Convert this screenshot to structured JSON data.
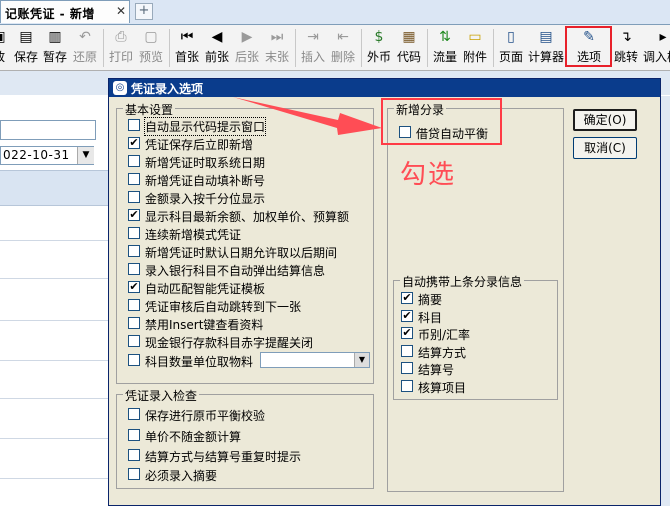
{
  "tab": {
    "title": "记账凭证 - 新增",
    "close": "✕",
    "new": "+"
  },
  "toolbar": {
    "items": [
      {
        "label": "放",
        "icon": "▣"
      },
      {
        "label": "保存",
        "icon": "▤"
      },
      {
        "label": "暂存",
        "icon": "▥"
      },
      {
        "label": "还原",
        "icon": "↶"
      },
      {
        "label": "打印",
        "icon": "⎙"
      },
      {
        "label": "预览",
        "icon": "▢"
      },
      {
        "label": "首张",
        "icon": "⏮"
      },
      {
        "label": "前张",
        "icon": "◀"
      },
      {
        "label": "后张",
        "icon": "▶"
      },
      {
        "label": "末张",
        "icon": "⏭"
      },
      {
        "label": "插入",
        "icon": "⇥"
      },
      {
        "label": "删除",
        "icon": "⇤"
      },
      {
        "label": "外币",
        "icon": "$"
      },
      {
        "label": "代码",
        "icon": "▦"
      },
      {
        "label": "流量",
        "icon": "⇅"
      },
      {
        "label": "附件",
        "icon": "▭"
      },
      {
        "label": "页面",
        "icon": "▯"
      },
      {
        "label": "计算器",
        "icon": "▤"
      },
      {
        "label": "选项",
        "icon": "✎"
      },
      {
        "label": "跳转",
        "icon": "↴"
      },
      {
        "label": "调入模",
        "icon": "▸"
      }
    ]
  },
  "background": {
    "date": "022-10-31"
  },
  "dialog": {
    "title": "凭证录入选项",
    "basic": {
      "legend": "基本设置",
      "options": [
        {
          "label": "自动显示代码提示窗口",
          "checked": false
        },
        {
          "label": "凭证保存后立即新增",
          "checked": true
        },
        {
          "label": "新增凭证时取系统日期",
          "checked": false
        },
        {
          "label": "新增凭证自动填补断号",
          "checked": false
        },
        {
          "label": "金额录入按千分位显示",
          "checked": false
        },
        {
          "label": "显示科目最新余额、加权单价、预算额",
          "checked": true
        },
        {
          "label": "连续新增模式凭证",
          "checked": false
        },
        {
          "label": "新增凭证时默认日期允许取以后期间",
          "checked": false
        },
        {
          "label": "录入银行科目不自动弹出结算信息",
          "checked": false
        },
        {
          "label": "自动匹配智能凭证模板",
          "checked": true
        },
        {
          "label": "凭证审核后自动跳转到下一张",
          "checked": false
        },
        {
          "label": "禁用Insert键查看资料",
          "checked": false
        },
        {
          "label": "现金银行存款科目赤字提醒关闭",
          "checked": false
        },
        {
          "label": "科目数量单位取物料",
          "checked": false
        }
      ]
    },
    "check": {
      "legend": "凭证录入检查",
      "options": [
        {
          "label": "保存进行原币平衡校验",
          "checked": false
        },
        {
          "label": "单价不随金额计算",
          "checked": false
        },
        {
          "label": "结算方式与结算号重复时提示",
          "checked": false
        },
        {
          "label": "必须录入摘要",
          "checked": false
        }
      ]
    },
    "new_entry": {
      "legend": "新增分录",
      "options": [
        {
          "label": "借贷自动平衡",
          "checked": false
        }
      ]
    },
    "carry": {
      "legend": "自动携带上条分录信息",
      "options": [
        {
          "label": "摘要",
          "checked": true
        },
        {
          "label": "科目",
          "checked": true
        },
        {
          "label": "币别/汇率",
          "checked": true
        },
        {
          "label": "结算方式",
          "checked": false
        },
        {
          "label": "结算号",
          "checked": false
        },
        {
          "label": "核算项目",
          "checked": false
        }
      ]
    },
    "ok_label": "确定(O)",
    "cancel_label": "取消(C)",
    "check_mark": "✔"
  },
  "annotation": {
    "text": "勾选"
  },
  "colors": {
    "highlight": "#e8202a",
    "annotation": "#ff4d55",
    "titlebar": "#0a3c8c"
  }
}
